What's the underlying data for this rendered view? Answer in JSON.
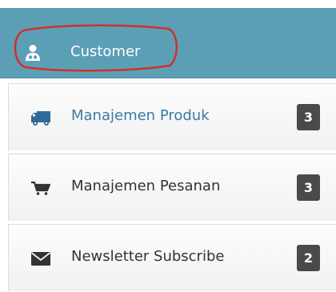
{
  "header": {
    "title": "Customer",
    "icon": "customer-icon",
    "color": "#5b9fb7"
  },
  "menu": {
    "items": [
      {
        "label": "Manajemen Produk",
        "badge": "3",
        "icon": "truck-icon",
        "active": true
      },
      {
        "label": "Manajemen Pesanan",
        "badge": "3",
        "icon": "cart-icon",
        "active": false
      },
      {
        "label": "Newsletter Subscribe",
        "badge": "2",
        "icon": "envelope-icon",
        "active": false
      }
    ]
  },
  "colors": {
    "active_text": "#3a7aa7",
    "badge_bg": "#4a4a4a",
    "annotation": "#d0302a"
  }
}
